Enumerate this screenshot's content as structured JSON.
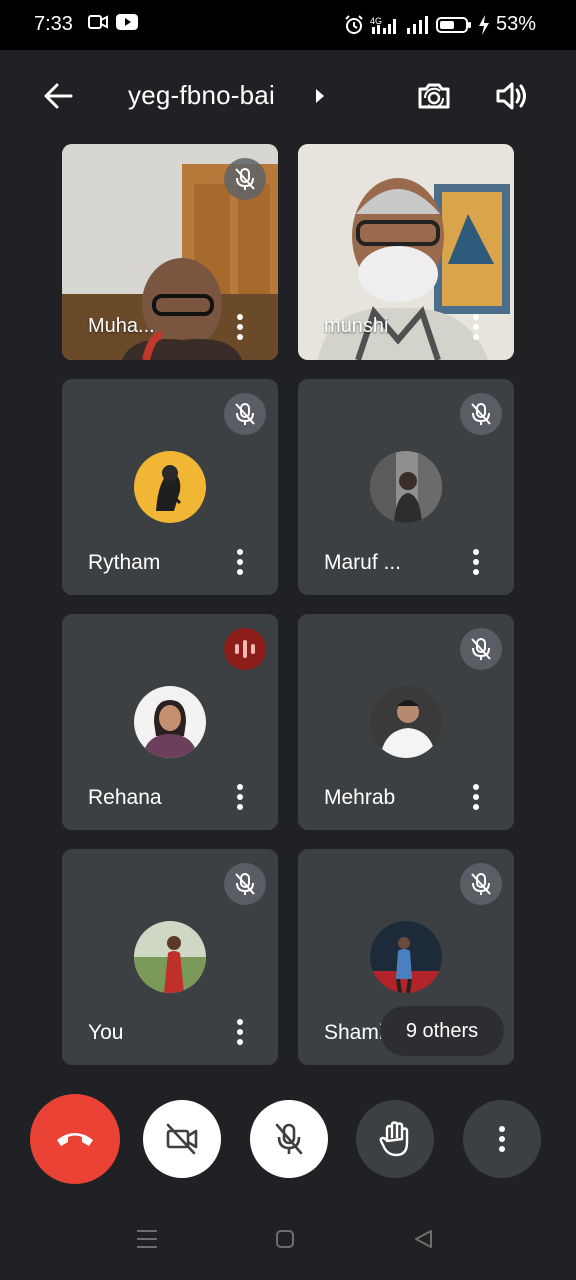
{
  "status_bar": {
    "time": "7:33",
    "network": "4G",
    "battery": "53%"
  },
  "header": {
    "meeting_code": "yeg-fbno-bai"
  },
  "participants": [
    {
      "name": "Muha...",
      "type": "video",
      "mic": "muted"
    },
    {
      "name": "munshi",
      "type": "video",
      "mic": "none"
    },
    {
      "name": "Rytham",
      "type": "avatar",
      "mic": "muted"
    },
    {
      "name": "Maruf ...",
      "type": "avatar",
      "mic": "muted"
    },
    {
      "name": "Rehana",
      "type": "avatar",
      "mic": "speaking"
    },
    {
      "name": "Mehrab",
      "type": "avatar",
      "mic": "muted"
    },
    {
      "name": "You",
      "type": "avatar",
      "mic": "muted"
    },
    {
      "name": "Shamim Ahmed",
      "type": "avatar",
      "mic": "muted"
    }
  ],
  "others_chip": "9 others",
  "controls": {
    "end_call": "end-call",
    "camera": "camera-off",
    "mic": "mic-off",
    "raise_hand": "raise-hand",
    "more": "more-options"
  },
  "colors": {
    "background": "#202124",
    "tile": "#3c4043",
    "end_call": "#ea4335",
    "speaking": "#8c1d18"
  }
}
